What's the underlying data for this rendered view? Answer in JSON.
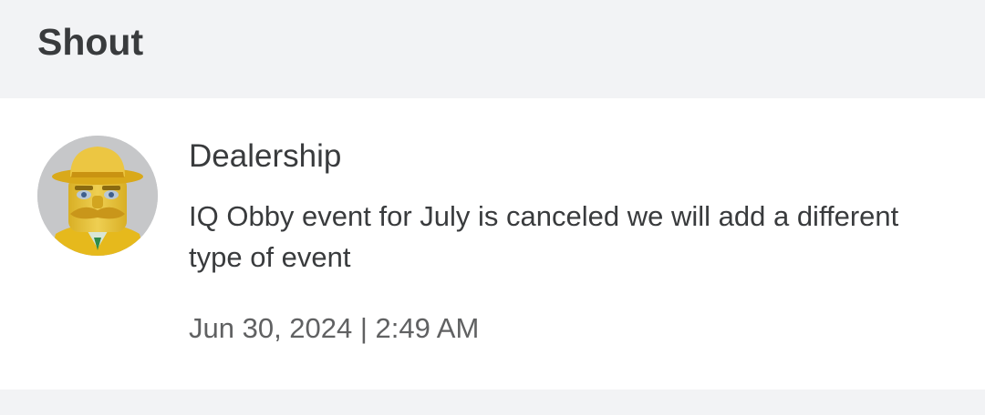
{
  "header": {
    "title": "Shout"
  },
  "shout": {
    "author": "Dealership",
    "message": "IQ Obby event for July is canceled we will add a different type of event",
    "timestamp": "Jun 30, 2024 | 2:49 AM",
    "avatar_icon": "user-avatar-gold-hat"
  },
  "colors": {
    "page_background": "#f2f3f5",
    "card_background": "#ffffff",
    "text_primary": "#393b3d",
    "text_secondary": "#606162",
    "avatar_gold": "#e8c22a"
  }
}
